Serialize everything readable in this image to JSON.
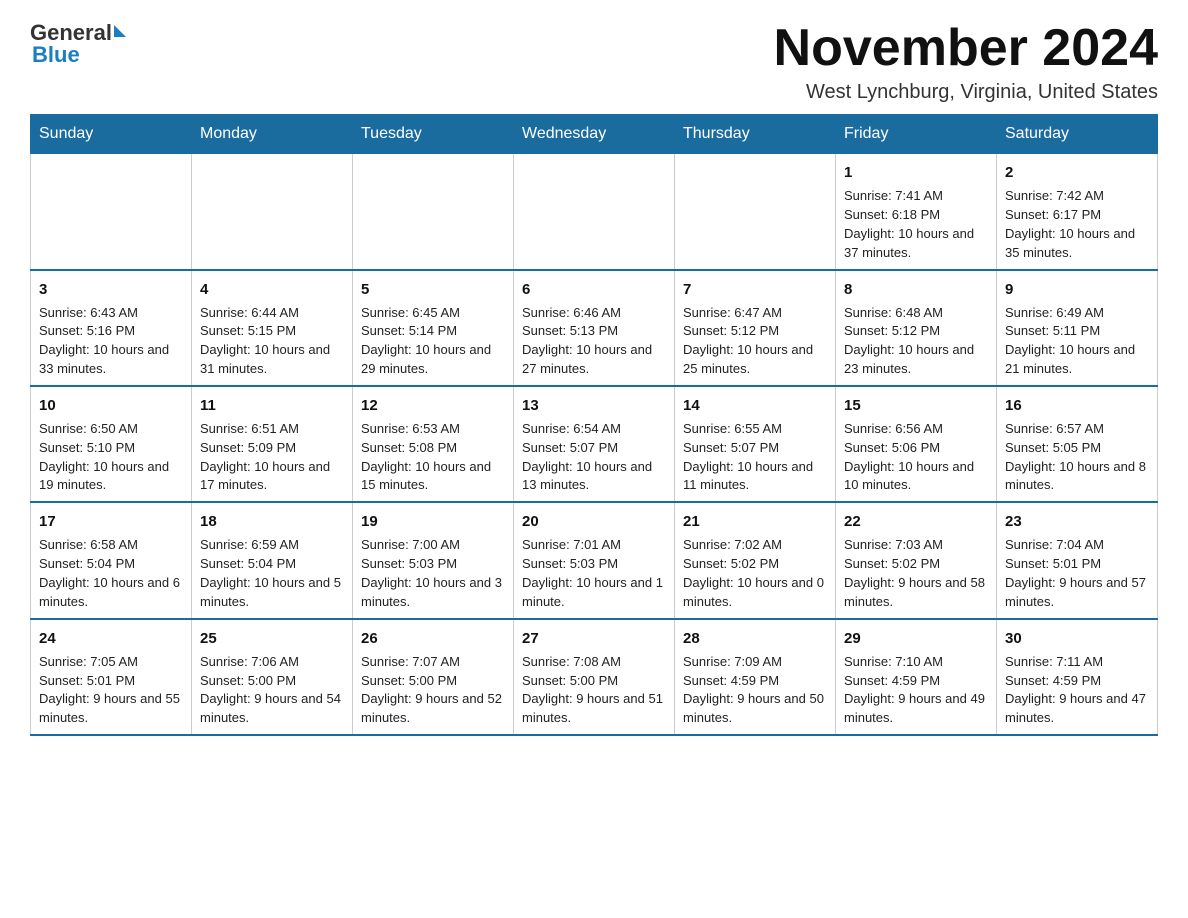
{
  "logo": {
    "name_black": "General",
    "name_blue": "Blue"
  },
  "header": {
    "title": "November 2024",
    "location": "West Lynchburg, Virginia, United States"
  },
  "days_of_week": [
    "Sunday",
    "Monday",
    "Tuesday",
    "Wednesday",
    "Thursday",
    "Friday",
    "Saturday"
  ],
  "weeks": [
    [
      {
        "day": "",
        "info": ""
      },
      {
        "day": "",
        "info": ""
      },
      {
        "day": "",
        "info": ""
      },
      {
        "day": "",
        "info": ""
      },
      {
        "day": "",
        "info": ""
      },
      {
        "day": "1",
        "info": "Sunrise: 7:41 AM\nSunset: 6:18 PM\nDaylight: 10 hours and 37 minutes."
      },
      {
        "day": "2",
        "info": "Sunrise: 7:42 AM\nSunset: 6:17 PM\nDaylight: 10 hours and 35 minutes."
      }
    ],
    [
      {
        "day": "3",
        "info": "Sunrise: 6:43 AM\nSunset: 5:16 PM\nDaylight: 10 hours and 33 minutes."
      },
      {
        "day": "4",
        "info": "Sunrise: 6:44 AM\nSunset: 5:15 PM\nDaylight: 10 hours and 31 minutes."
      },
      {
        "day": "5",
        "info": "Sunrise: 6:45 AM\nSunset: 5:14 PM\nDaylight: 10 hours and 29 minutes."
      },
      {
        "day": "6",
        "info": "Sunrise: 6:46 AM\nSunset: 5:13 PM\nDaylight: 10 hours and 27 minutes."
      },
      {
        "day": "7",
        "info": "Sunrise: 6:47 AM\nSunset: 5:12 PM\nDaylight: 10 hours and 25 minutes."
      },
      {
        "day": "8",
        "info": "Sunrise: 6:48 AM\nSunset: 5:12 PM\nDaylight: 10 hours and 23 minutes."
      },
      {
        "day": "9",
        "info": "Sunrise: 6:49 AM\nSunset: 5:11 PM\nDaylight: 10 hours and 21 minutes."
      }
    ],
    [
      {
        "day": "10",
        "info": "Sunrise: 6:50 AM\nSunset: 5:10 PM\nDaylight: 10 hours and 19 minutes."
      },
      {
        "day": "11",
        "info": "Sunrise: 6:51 AM\nSunset: 5:09 PM\nDaylight: 10 hours and 17 minutes."
      },
      {
        "day": "12",
        "info": "Sunrise: 6:53 AM\nSunset: 5:08 PM\nDaylight: 10 hours and 15 minutes."
      },
      {
        "day": "13",
        "info": "Sunrise: 6:54 AM\nSunset: 5:07 PM\nDaylight: 10 hours and 13 minutes."
      },
      {
        "day": "14",
        "info": "Sunrise: 6:55 AM\nSunset: 5:07 PM\nDaylight: 10 hours and 11 minutes."
      },
      {
        "day": "15",
        "info": "Sunrise: 6:56 AM\nSunset: 5:06 PM\nDaylight: 10 hours and 10 minutes."
      },
      {
        "day": "16",
        "info": "Sunrise: 6:57 AM\nSunset: 5:05 PM\nDaylight: 10 hours and 8 minutes."
      }
    ],
    [
      {
        "day": "17",
        "info": "Sunrise: 6:58 AM\nSunset: 5:04 PM\nDaylight: 10 hours and 6 minutes."
      },
      {
        "day": "18",
        "info": "Sunrise: 6:59 AM\nSunset: 5:04 PM\nDaylight: 10 hours and 5 minutes."
      },
      {
        "day": "19",
        "info": "Sunrise: 7:00 AM\nSunset: 5:03 PM\nDaylight: 10 hours and 3 minutes."
      },
      {
        "day": "20",
        "info": "Sunrise: 7:01 AM\nSunset: 5:03 PM\nDaylight: 10 hours and 1 minute."
      },
      {
        "day": "21",
        "info": "Sunrise: 7:02 AM\nSunset: 5:02 PM\nDaylight: 10 hours and 0 minutes."
      },
      {
        "day": "22",
        "info": "Sunrise: 7:03 AM\nSunset: 5:02 PM\nDaylight: 9 hours and 58 minutes."
      },
      {
        "day": "23",
        "info": "Sunrise: 7:04 AM\nSunset: 5:01 PM\nDaylight: 9 hours and 57 minutes."
      }
    ],
    [
      {
        "day": "24",
        "info": "Sunrise: 7:05 AM\nSunset: 5:01 PM\nDaylight: 9 hours and 55 minutes."
      },
      {
        "day": "25",
        "info": "Sunrise: 7:06 AM\nSunset: 5:00 PM\nDaylight: 9 hours and 54 minutes."
      },
      {
        "day": "26",
        "info": "Sunrise: 7:07 AM\nSunset: 5:00 PM\nDaylight: 9 hours and 52 minutes."
      },
      {
        "day": "27",
        "info": "Sunrise: 7:08 AM\nSunset: 5:00 PM\nDaylight: 9 hours and 51 minutes."
      },
      {
        "day": "28",
        "info": "Sunrise: 7:09 AM\nSunset: 4:59 PM\nDaylight: 9 hours and 50 minutes."
      },
      {
        "day": "29",
        "info": "Sunrise: 7:10 AM\nSunset: 4:59 PM\nDaylight: 9 hours and 49 minutes."
      },
      {
        "day": "30",
        "info": "Sunrise: 7:11 AM\nSunset: 4:59 PM\nDaylight: 9 hours and 47 minutes."
      }
    ]
  ]
}
